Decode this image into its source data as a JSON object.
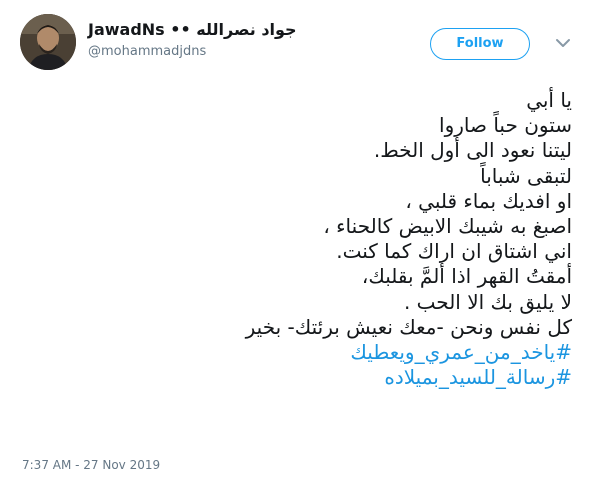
{
  "tweet": {
    "display_name": "JawadNs •• جواد نصرالله",
    "handle": "@mohammadjdns",
    "follow_label": "Follow",
    "lines": [
      "يا أبي",
      "ستون حباً صاروا",
      "ليتنا نعود الى أول الخط.",
      "لتبقى شباباً",
      "او افديك بماء قلبي ،",
      "اصبغ به شيبك الابيض كالحناء ،",
      "اني اشتاق ان اراك كما كنت.",
      "أمقتُ القهر اذا ألمَّ بقلبك،",
      "لا يليق بك الا الحب .",
      "كل نفس ونحن -معك نعيش برئتك- بخير"
    ],
    "hashtags": [
      "#ياخد_من_عمري_ويعطيك",
      "#رسالة_للسيد_بميلاده"
    ],
    "timestamp": "7:37 AM - 27 Nov 2019"
  },
  "colors": {
    "accent": "#1da1f2",
    "hashtag": "#1b95e0",
    "secondary_text": "#657786",
    "primary_text": "#14171a"
  },
  "icons": {
    "avatar": "profile-photo",
    "menu": "chevron-down-icon"
  }
}
